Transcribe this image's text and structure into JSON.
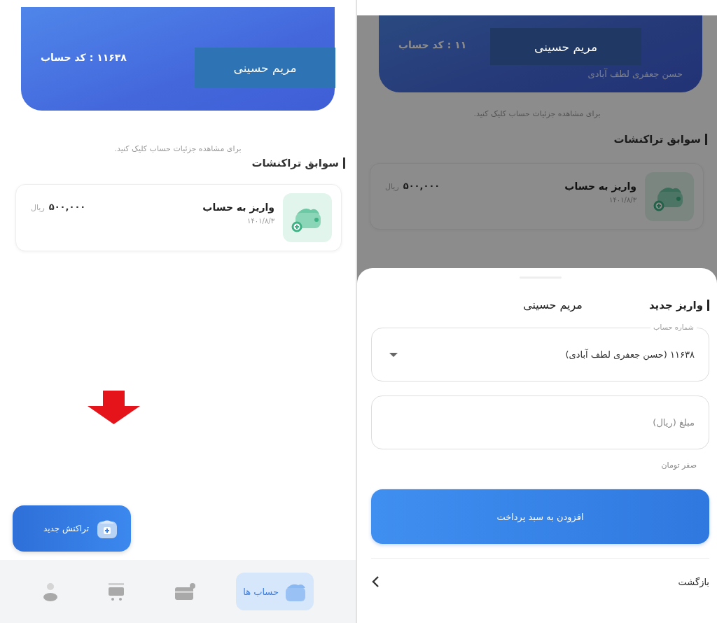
{
  "left_screen": {
    "account_card": {
      "code_line": "۱۱۶۳۸ : کد حساب"
    },
    "name_overlay": "مریم حسینی",
    "hint": "برای مشاهده جزئیات حساب کلیک کنید.",
    "section_title": "سوابق تراکنشات",
    "transactions": [
      {
        "title": "واریز به حساب",
        "date": "۱۴۰۱/۸/۳",
        "amount": "۵۰۰,۰۰۰",
        "currency": "ریال"
      }
    ],
    "new_transaction_button": "تراکنش جدید",
    "bottom_nav": [
      {
        "kind": "wallet",
        "label": "حساب ها",
        "selected": true
      },
      {
        "kind": "card",
        "selected": false
      },
      {
        "kind": "cart",
        "selected": false
      },
      {
        "kind": "person",
        "selected": false
      }
    ]
  },
  "right_screen": {
    "account_card": {
      "code_line": "۱۱ : کد حساب",
      "owner": "حسن جعفری لطف آبادی"
    },
    "name_overlay": "مریم حسینی",
    "hint": "برای مشاهده جزئیات حساب کلیک کنید.",
    "section_title": "سوابق تراکنشات",
    "transactions": [
      {
        "title": "واریز به حساب",
        "date": "۱۴۰۱/۸/۳",
        "amount": "۵۰۰,۰۰۰",
        "currency": "ریال"
      }
    ],
    "sheet": {
      "title": "واریز جدید",
      "name_note": "مریم حسینی",
      "account_field": {
        "label": "شماره حساب",
        "value": "۱۱۶۳۸ (حسن جعفری لطف آبادی)"
      },
      "amount_field": {
        "placeholder": "مبلغ (ریال)"
      },
      "helper": "صفر تومان",
      "submit_button": "افزودن به سبد پرداخت",
      "back": "بازگشت"
    }
  }
}
